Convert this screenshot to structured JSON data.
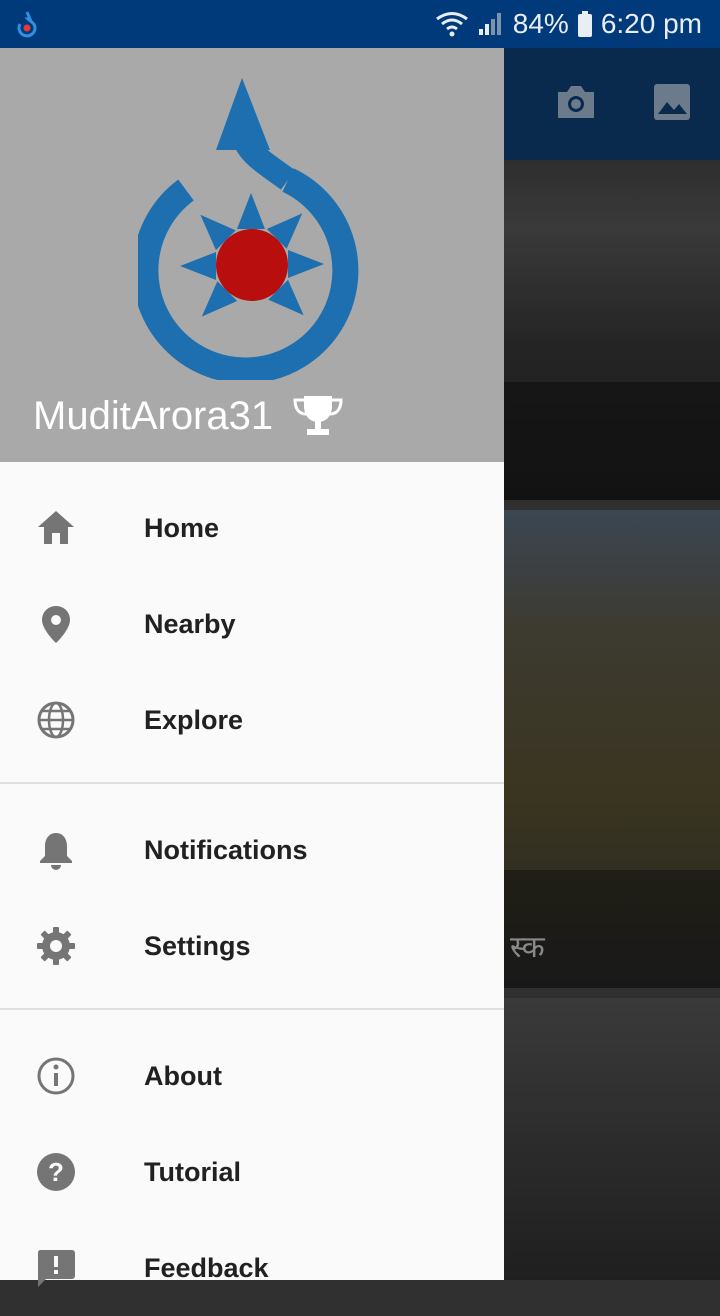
{
  "status_bar": {
    "battery": "84%",
    "time": "6:20 pm"
  },
  "toolbar": {
    "camera_icon": "camera-icon",
    "gallery_icon": "gallery-icon"
  },
  "background": {
    "photo2_caption": "स्क"
  },
  "drawer": {
    "username": "MuditArora31",
    "sections": [
      [
        {
          "label": "Home",
          "icon": "home-icon"
        },
        {
          "label": "Nearby",
          "icon": "location-pin-icon"
        },
        {
          "label": "Explore",
          "icon": "globe-icon"
        }
      ],
      [
        {
          "label": "Notifications",
          "icon": "bell-icon"
        },
        {
          "label": "Settings",
          "icon": "gear-icon"
        }
      ],
      [
        {
          "label": "About",
          "icon": "info-icon"
        },
        {
          "label": "Tutorial",
          "icon": "help-icon"
        },
        {
          "label": "Feedback",
          "icon": "feedback-icon"
        }
      ]
    ]
  },
  "colors": {
    "status_bar": "#003a7a",
    "drawer_header": "#a9a9a9",
    "logo_blue": "#1d6fb0",
    "logo_red": "#b80e0e"
  }
}
